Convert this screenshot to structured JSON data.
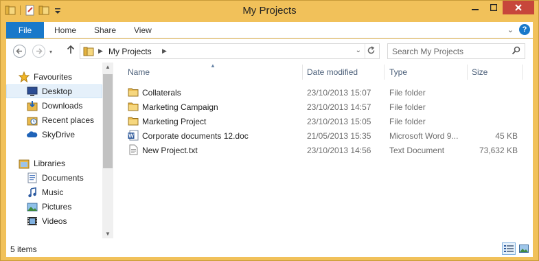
{
  "window": {
    "title": "My Projects"
  },
  "ribbon": {
    "file_tab": "File",
    "tabs": [
      "Home",
      "Share",
      "View"
    ],
    "help_label": "?"
  },
  "address": {
    "path_label": "My Projects",
    "search_placeholder": "Search My Projects"
  },
  "nav": {
    "favourites": {
      "label": "Favourites",
      "items": [
        "Desktop",
        "Downloads",
        "Recent places",
        "SkyDrive"
      ],
      "selected": "Desktop"
    },
    "libraries": {
      "label": "Libraries",
      "items": [
        "Documents",
        "Music",
        "Pictures",
        "Videos"
      ]
    }
  },
  "list": {
    "columns": [
      "Name",
      "Date modified",
      "Type",
      "Size"
    ],
    "rows": [
      {
        "name": "Collaterals",
        "date": "23/10/2013 15:07",
        "type": "File folder",
        "size": "",
        "icon": "folder-icon"
      },
      {
        "name": "Marketing Campaign",
        "date": "23/10/2013 14:57",
        "type": "File folder",
        "size": "",
        "icon": "folder-icon"
      },
      {
        "name": "Marketing Project",
        "date": "23/10/2013 15:05",
        "type": "File folder",
        "size": "",
        "icon": "folder-icon"
      },
      {
        "name": "Corporate documents 12.doc",
        "date": "21/05/2013 15:35",
        "type": "Microsoft Word 9...",
        "size": "45 KB",
        "icon": "word-doc-icon"
      },
      {
        "name": "New Project.txt",
        "date": "23/10/2013 14:56",
        "type": "Text Document",
        "size": "73,632 KB",
        "icon": "text-file-icon"
      }
    ]
  },
  "status": {
    "item_count": "5 items"
  },
  "colors": {
    "frame": "#f1c15a",
    "file_tab": "#1979ca",
    "close_button": "#c7463b",
    "folder": "#e8b84a"
  }
}
